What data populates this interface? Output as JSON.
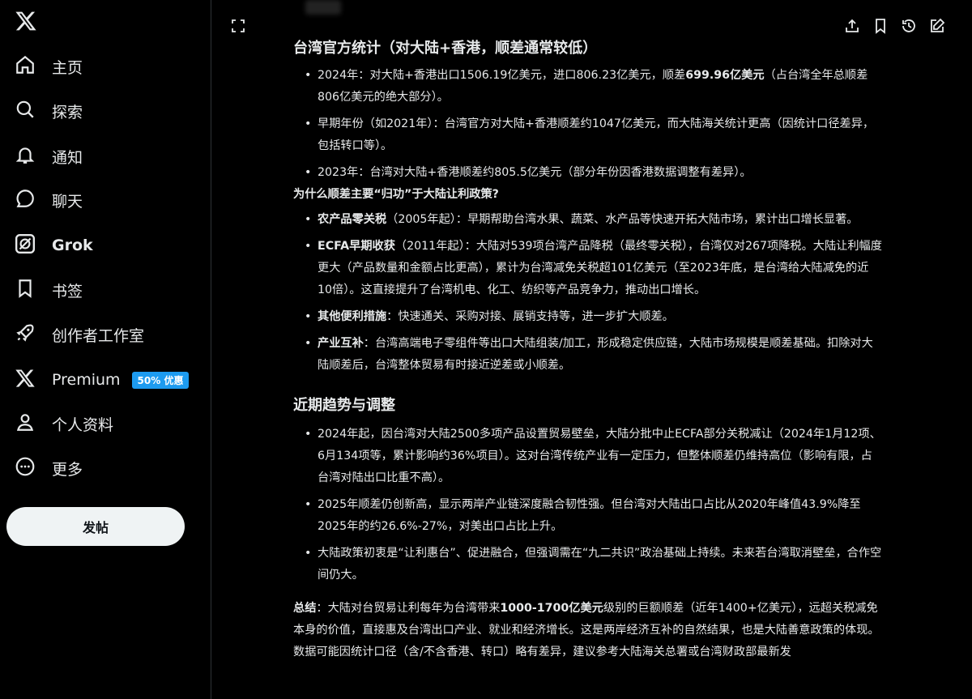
{
  "sidebar": {
    "items": [
      {
        "label": "主页",
        "icon": "home-icon"
      },
      {
        "label": "探索",
        "icon": "search-icon"
      },
      {
        "label": "通知",
        "icon": "bell-icon"
      },
      {
        "label": "聊天",
        "icon": "chat-icon"
      },
      {
        "label": "Grok",
        "icon": "grok-icon"
      },
      {
        "label": "书签",
        "icon": "bookmark-icon"
      },
      {
        "label": "创作者工作室",
        "icon": "rocket-icon"
      },
      {
        "label": "Premium",
        "icon": "x-premium-icon",
        "badge": "50% 优惠"
      },
      {
        "label": "个人资料",
        "icon": "person-icon"
      },
      {
        "label": "更多",
        "icon": "more-icon"
      }
    ],
    "post_label": "发帖"
  },
  "colors": {
    "badge": "#1d9bf0",
    "background": "#000000",
    "text": "#e7e9ea"
  },
  "article": {
    "section1_title": "台湾官方统计（对大陆+香港，顺差通常较低）",
    "s1_items": [
      {
        "pre": "2024年：对大陆+香港出口1506.19亿美元，进口806.23亿美元，顺差",
        "bold": "699.96亿美元",
        "post": "（占台湾全年总顺差806亿美元的绝大部分）。"
      },
      {
        "pre": "早期年份（如2021年）：台湾官方对大陆+香港顺差约1047亿美元，而大陆海关统计更高（因统计口径差异，包括转口等）。"
      },
      {
        "pre": "2023年：台湾对大陆+香港顺差约805.5亿美元（部分年份因香港数据调整有差异）。"
      }
    ],
    "question": "为什么顺差主要“归功”于大陆让利政策?",
    "s2_items": [
      {
        "bold": "农产品零关税",
        "post": "（2005年起）：早期帮助台湾水果、蔬菜、水产品等快速开拓大陆市场，累计出口增长显著。"
      },
      {
        "bold": "ECFA早期收获",
        "post": "（2011年起）：大陆对539项台湾产品降税（最终零关税），台湾仅对267项降税。大陆让利幅度更大（产品数量和金额占比更高），累计为台湾减免关税超101亿美元（至2023年底，是台湾给大陆减免的近10倍）。这直接提升了台湾机电、化工、纺织等产品竞争力，推动出口增长。"
      },
      {
        "bold": "其他便利措施",
        "post": "：快速通关、采购对接、展销支持等，进一步扩大顺差。"
      },
      {
        "bold": "产业互补",
        "post": "：台湾高端电子零组件等出口大陆组装/加工，形成稳定供应链，大陆市场规模是顺差基础。扣除对大陆顺差后，台湾整体贸易有时接近逆差或小顺差。"
      }
    ],
    "section2_title": "近期趋势与调整",
    "s3_items": [
      {
        "pre": "2024年起，因台湾对大陆2500多项产品设置贸易壁垒，大陆分批中止ECFA部分关税减让（2024年1月12项、6月134项等，累计影响约36%项目）。这对台湾传统产业有一定压力，但整体顺差仍维持高位（影响有限，占台湾对陆出口比重不高）。"
      },
      {
        "pre": "2025年顺差仍创新高，显示两岸产业链深度融合韧性强。但台湾对大陆出口占比从2020年峰值43.9%降至2025年的约26.6%-27%，对美出口占比上升。"
      },
      {
        "pre": "大陆政策初衷是“让利惠台”、促进融合，但强调需在“九二共识”政治基础上持续。未来若台湾取消壁垒，合作空间仍大。"
      }
    ],
    "summary": {
      "label": "总结",
      "pre": "：大陆对台贸易让利每年为台湾带来",
      "bold": "1000-1700亿美元",
      "post": "级别的巨额顺差（近年1400+亿美元），远超关税减免本身的价值，直接惠及台湾出口产业、就业和经济增长。这是两岸经济互补的自然结果，也是大陆善意政策的体现。数据可能因统计口径（含/不含香港、转口）略有差异，建议参考大陆海关总署或台湾财政部最新发"
    }
  }
}
